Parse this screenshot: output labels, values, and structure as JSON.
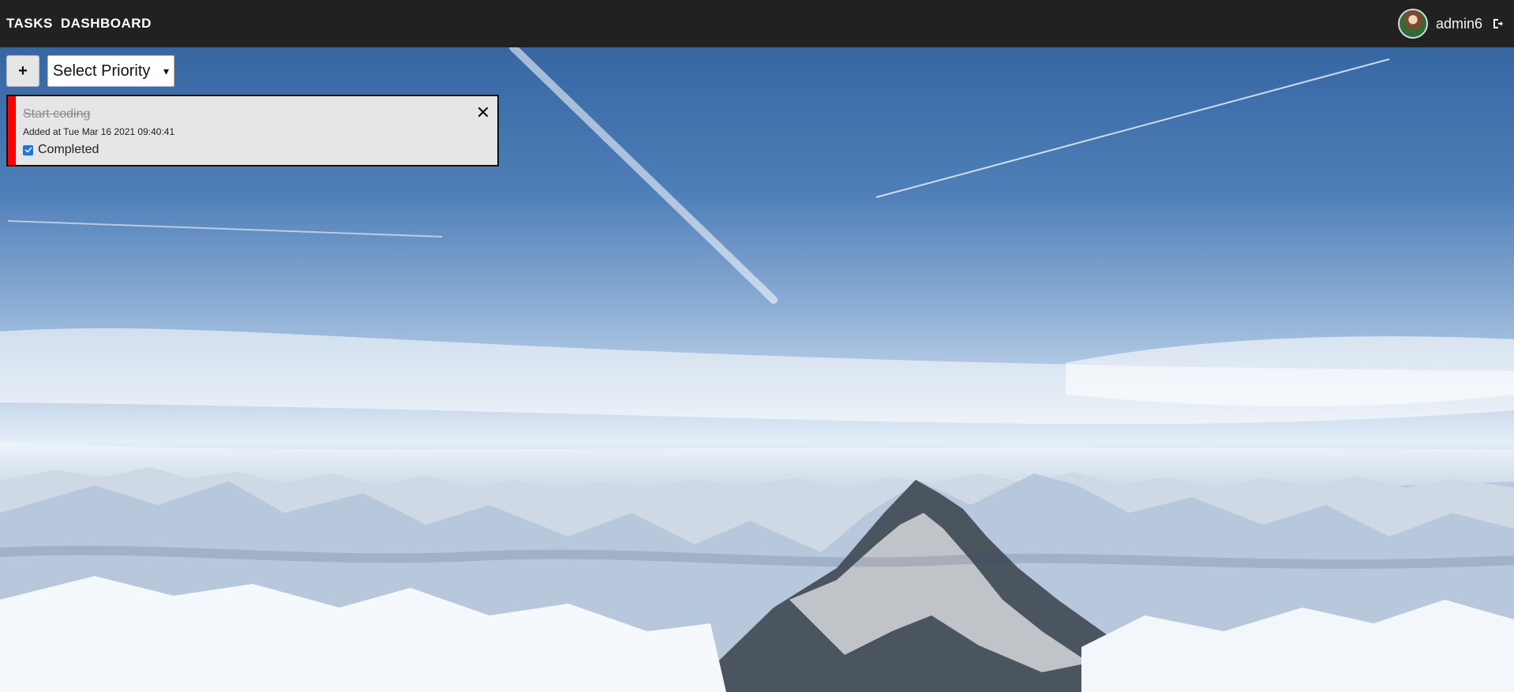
{
  "nav": {
    "brand_1": "TASKS",
    "brand_2": "DASHBOARD",
    "username": "admin6"
  },
  "controls": {
    "add_label": "+",
    "priority_selected": "Select Priority"
  },
  "tasks": [
    {
      "title": "Start coding",
      "added_at": "Added at Tue Mar 16 2021 09:40:41",
      "completed_label": "Completed",
      "completed": true
    }
  ],
  "colors": {
    "nav_bg": "#212121",
    "task_accent": "#ff0000",
    "task_bg": "#e6e6e6"
  },
  "icons": {
    "logout": "logout-icon",
    "close": "close-icon",
    "avatar": "avatar"
  }
}
